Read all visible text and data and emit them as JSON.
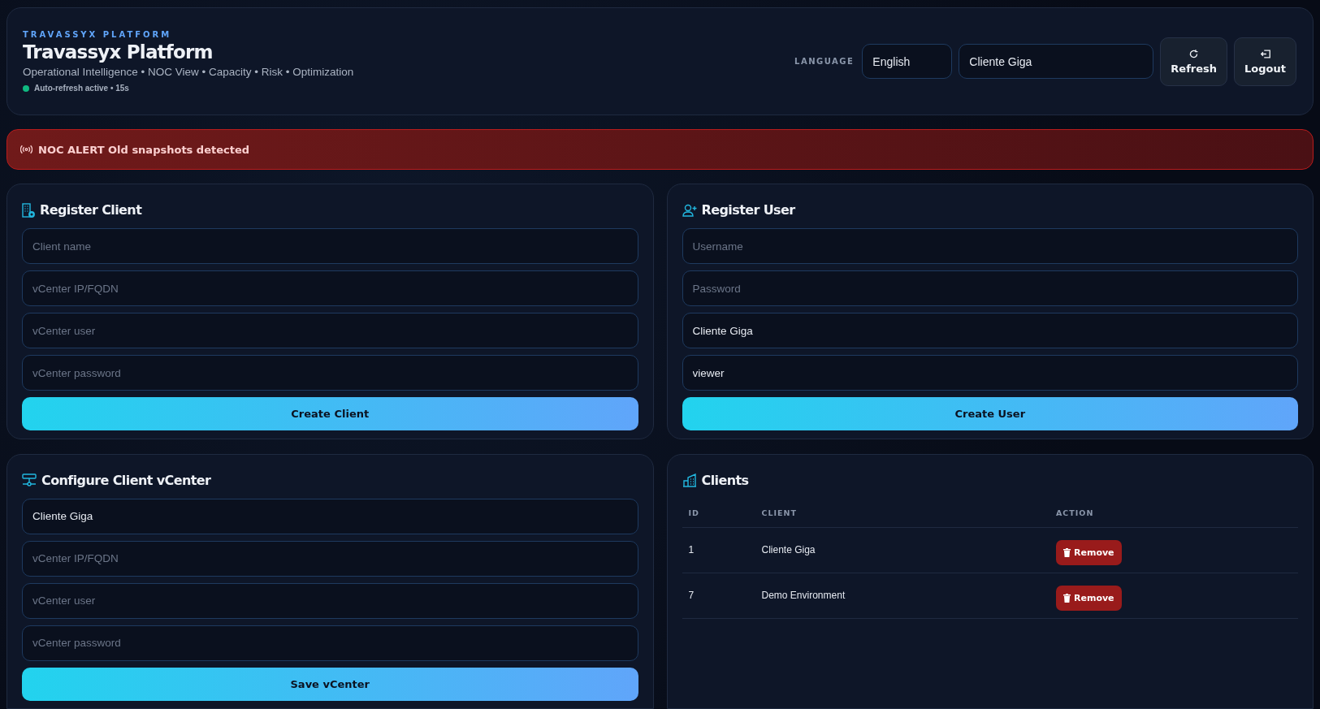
{
  "header": {
    "eyebrow": "TRAVASSYX PLATFORM",
    "title": "Travassyx Platform",
    "subtitle": "Operational Intelligence • NOC View • Capacity • Risk • Optimization",
    "status": {
      "text": "Auto-refresh active • 15s",
      "on": true
    },
    "language_label": "LANGUAGE",
    "language_value": "English",
    "client_value": "Cliente Giga",
    "buttons": [
      {
        "kind": "refresh",
        "label": "Refresh"
      },
      {
        "kind": "logout",
        "label": "Logout"
      }
    ]
  },
  "alert": {
    "text": "NOC ALERT Old snapshots detected"
  },
  "panels": [
    {
      "kind": "form",
      "title": "Register Client",
      "fields": [
        {
          "placeholder": "Client name"
        },
        {
          "placeholder": "vCenter IP/FQDN"
        },
        {
          "placeholder": "vCenter user"
        },
        {
          "placeholder": "vCenter password"
        }
      ],
      "button": "Create Client"
    },
    {
      "kind": "form",
      "title": "Register User",
      "fields": [
        {
          "placeholder": "Username"
        },
        {
          "placeholder": "Password"
        },
        {
          "value": "Cliente Giga"
        },
        {
          "value": "viewer"
        }
      ],
      "button": "Create User"
    },
    {
      "kind": "form",
      "title": "Configure Client vCenter",
      "fields": [
        {
          "value": "Cliente Giga"
        },
        {
          "placeholder": "vCenter IP/FQDN"
        },
        {
          "placeholder": "vCenter user"
        },
        {
          "placeholder": "vCenter password"
        }
      ],
      "button": "Save vCenter"
    },
    {
      "kind": "table",
      "title": "Clients",
      "columns": [
        "ID",
        "CLIENT",
        "ACTION"
      ],
      "rows": [
        {
          "id": "1",
          "client": "Cliente Giga",
          "action": "Remove"
        },
        {
          "id": "7",
          "client": "Demo Environment",
          "action": "Remove"
        }
      ]
    }
  ]
}
